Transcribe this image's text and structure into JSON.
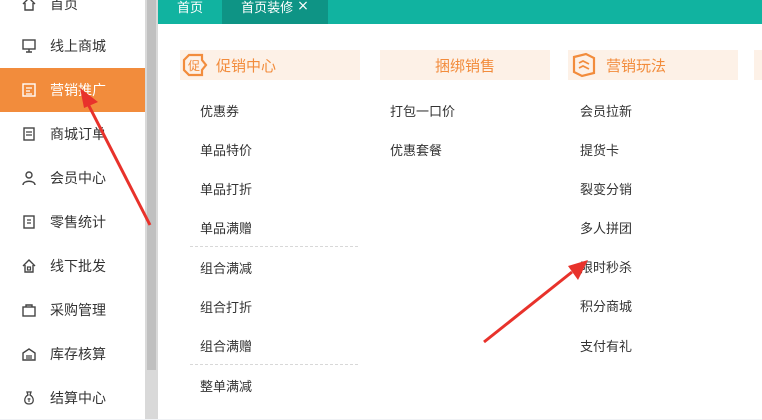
{
  "sidebar": {
    "items": [
      {
        "label": "首页",
        "icon": "home-icon"
      },
      {
        "label": "线上商城",
        "icon": "monitor-icon"
      },
      {
        "label": "营销推广",
        "icon": "megaphone-icon"
      },
      {
        "label": "商城订单",
        "icon": "order-icon"
      },
      {
        "label": "会员中心",
        "icon": "user-icon"
      },
      {
        "label": "零售统计",
        "icon": "stats-icon"
      },
      {
        "label": "线下批发",
        "icon": "house-icon"
      },
      {
        "label": "采购管理",
        "icon": "bag-icon"
      },
      {
        "label": "库存核算",
        "icon": "warehouse-icon"
      },
      {
        "label": "结算中心",
        "icon": "money-bag-icon"
      }
    ]
  },
  "tabs": [
    {
      "label": "首页"
    },
    {
      "label": "首页装修",
      "close": "×"
    }
  ],
  "categories": {
    "promo": {
      "title": "促销中心",
      "badge": "促",
      "items": [
        "优惠券",
        "单品特价",
        "单品打折",
        "单品满赠",
        "组合满减",
        "组合打折",
        "组合满赠",
        "整单满减"
      ]
    },
    "bundle": {
      "title": "捆绑销售",
      "items": [
        "打包一口价",
        "优惠套餐"
      ]
    },
    "play": {
      "title": "营销玩法",
      "items": [
        "会员拉新",
        "提货卡",
        "裂变分销",
        "多人拼团",
        "限时秒杀",
        "积分商城",
        "支付有礼"
      ]
    }
  },
  "colors": {
    "accent": "#f28c3c",
    "teal": "#11b3a0",
    "arrow": "#e8322b"
  }
}
